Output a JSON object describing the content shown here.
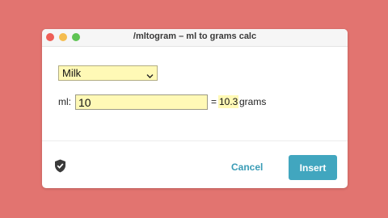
{
  "window": {
    "title": "/mltogram – ml to grams calc"
  },
  "form": {
    "ingredient_selected": "Milk",
    "ml_label": "ml:",
    "ml_value": "10",
    "equals": "=",
    "result_value": "10.3",
    "result_unit": "grams"
  },
  "footer": {
    "cancel_label": "Cancel",
    "insert_label": "Insert"
  },
  "icons": {
    "select": "chevron-down-icon",
    "footer": "shield-check-icon"
  },
  "colors": {
    "background": "#e27470",
    "field_highlight": "#fff9b6",
    "accent": "#41a6bf"
  }
}
